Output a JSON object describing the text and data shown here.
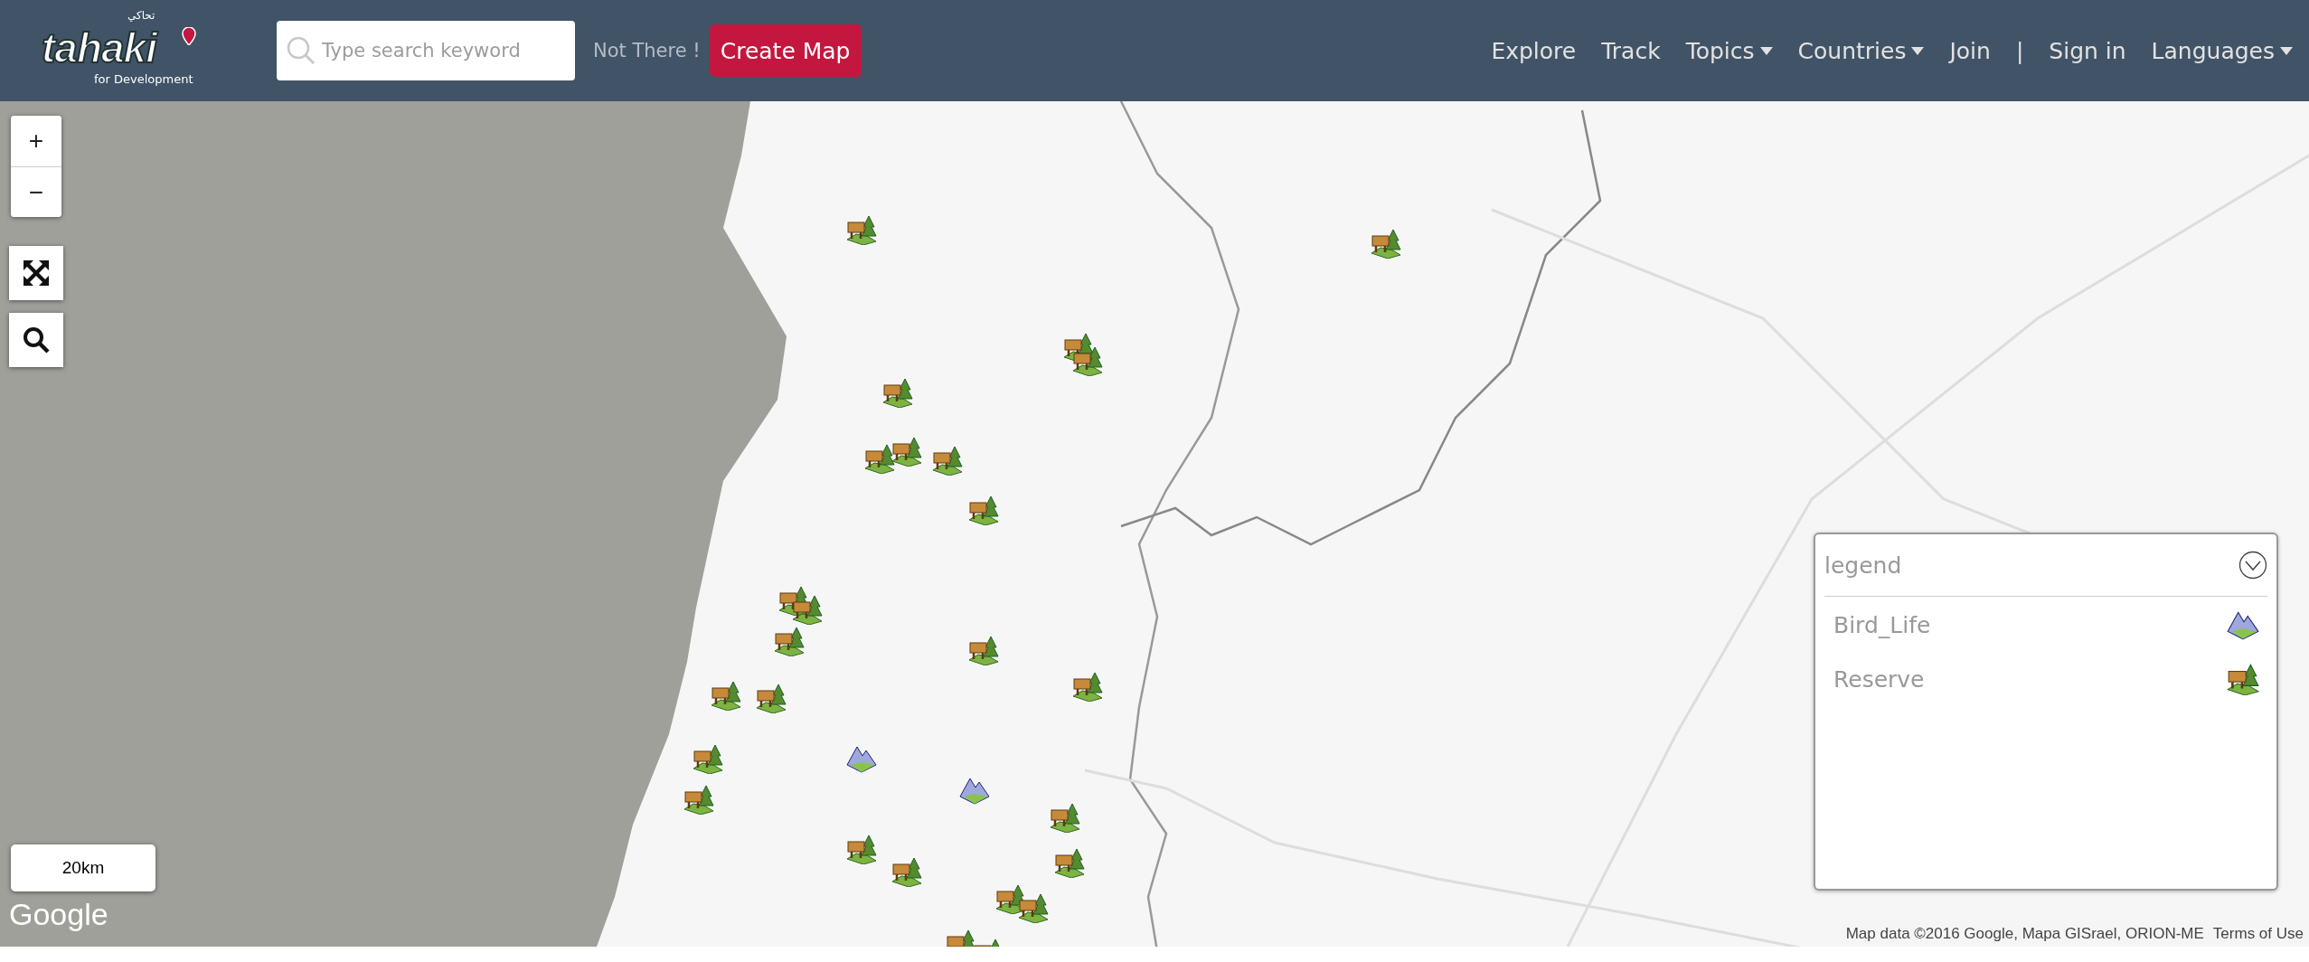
{
  "header": {
    "logo": {
      "name": "tahaki",
      "arabic": "تحاكي",
      "tagline": "for Development"
    },
    "search": {
      "placeholder": "Type search keyword"
    },
    "not_there": "Not There !",
    "create_button": "Create Map",
    "nav": [
      {
        "label": "Explore",
        "kind": "link"
      },
      {
        "label": "Track",
        "kind": "link"
      },
      {
        "label": "Topics",
        "kind": "dropdown"
      },
      {
        "label": "Countries",
        "kind": "dropdown"
      },
      {
        "label": "Join",
        "kind": "link"
      },
      {
        "label": "|",
        "kind": "separator"
      },
      {
        "label": "Sign in",
        "kind": "link"
      },
      {
        "label": "Languages",
        "kind": "dropdown"
      }
    ]
  },
  "map": {
    "zoom_in": "+",
    "zoom_out": "−",
    "scale": "20km",
    "provider": "Google",
    "attribution": "Map data ©2016 Google, Mapa GISrael, ORION-ME",
    "terms": "Terms of Use",
    "legend": {
      "title": "legend",
      "items": [
        {
          "label": "Bird_Life",
          "kind": "mountain"
        },
        {
          "label": "Reserve",
          "kind": "reserve"
        }
      ]
    }
  }
}
